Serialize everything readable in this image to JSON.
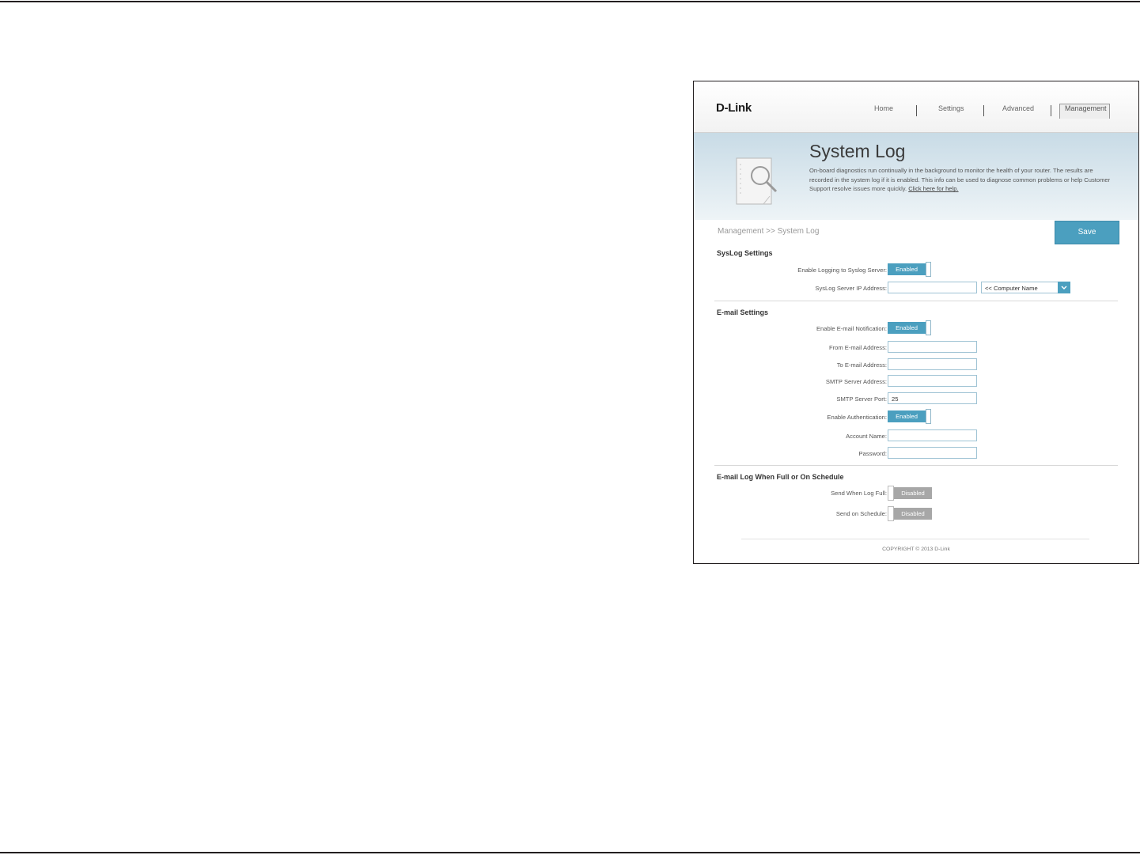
{
  "brand": "D-Link",
  "nav": {
    "home": "Home",
    "settings": "Settings",
    "advanced": "Advanced",
    "management": "Management"
  },
  "hero": {
    "title": "System Log",
    "description": "On-board diagnostics run continually in the background to monitor the health of your router. The results are recorded in the system log if it is enabled. This info can be used to diagnose common problems or help Customer Support resolve issues more quickly.",
    "help_link": "Click here for help."
  },
  "breadcrumb": "Management >> System Log",
  "save_label": "Save",
  "syslog": {
    "title": "SysLog Settings",
    "enable_label": "Enable Logging to Syslog Server:",
    "enable_state": "Enabled",
    "ip_label": "SysLog Server IP Address:",
    "ip_value": "",
    "computer_select": "<< Computer Name"
  },
  "email": {
    "title": "E-mail Settings",
    "enable_label": "Enable E-mail Notification:",
    "enable_state": "Enabled",
    "from_label": "From E-mail Address:",
    "from_value": "",
    "to_label": "To E-mail Address:",
    "to_value": "",
    "smtp_label": "SMTP Server Address:",
    "smtp_value": "",
    "port_label": "SMTP Server Port:",
    "port_value": "25",
    "auth_label": "Enable Authentication:",
    "auth_state": "Enabled",
    "account_label": "Account Name:",
    "account_value": "",
    "password_label": "Password:",
    "password_value": ""
  },
  "schedule": {
    "title": "E-mail Log When Full or On Schedule",
    "full_label": "Send When Log Full:",
    "full_state": "Disabled",
    "schedule_label": "Send on Schedule:",
    "schedule_state": "Disabled"
  },
  "footer": "COPYRIGHT © 2013 D-Link",
  "colors": {
    "accent": "#4b9fbf",
    "disabled": "#a7a7a7"
  }
}
